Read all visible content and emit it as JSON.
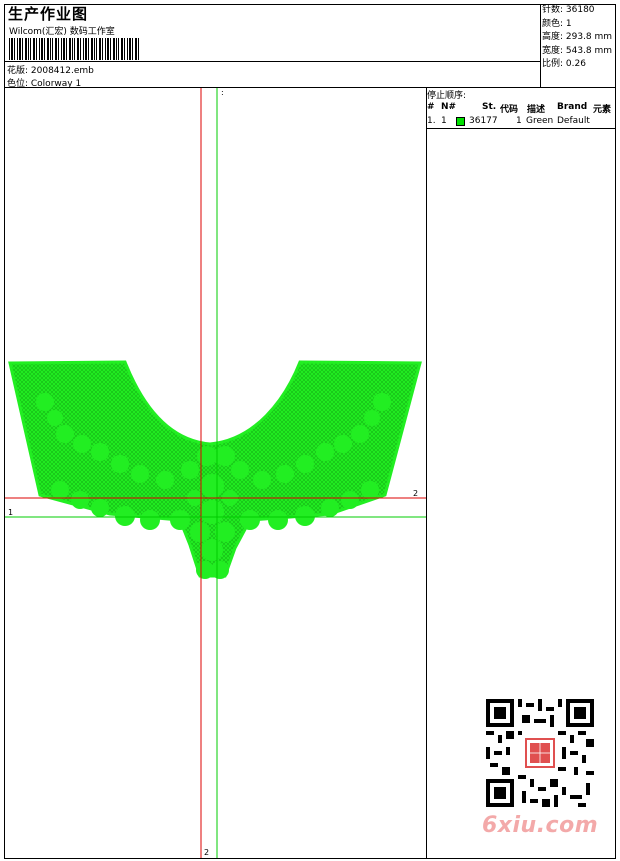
{
  "header": {
    "title": "生产作业图",
    "company": "Wilcom(汇宏) 数码工作室",
    "design_file": "花版: 2008412.emb",
    "colorway": "色位: Colorway 1"
  },
  "stats": [
    "针数: 36180",
    "颜色: 1",
    "高度: 293.8 mm",
    "宽度: 543.8 mm",
    "比例: 0.26"
  ],
  "color_table": {
    "title": "停止顺序:",
    "headers": [
      "#",
      "N#",
      "St.",
      "代码",
      "描述",
      "Brand",
      "元素"
    ],
    "rows": [
      {
        "index": "1.",
        "n": "1",
        "stitches": "36177",
        "code": "1",
        "description": "Green",
        "brand": "Default",
        "swatch": "#00e000"
      }
    ]
  },
  "axes": {
    "label_top": ":",
    "label_left": "1",
    "label_right": "2",
    "label_bottom": "2"
  },
  "colors": {
    "fill": "#22ee22",
    "stitch": "#18c818",
    "axis_red": "#dd0000",
    "axis_green": "#00cc00"
  },
  "watermark": "6xiu.com"
}
